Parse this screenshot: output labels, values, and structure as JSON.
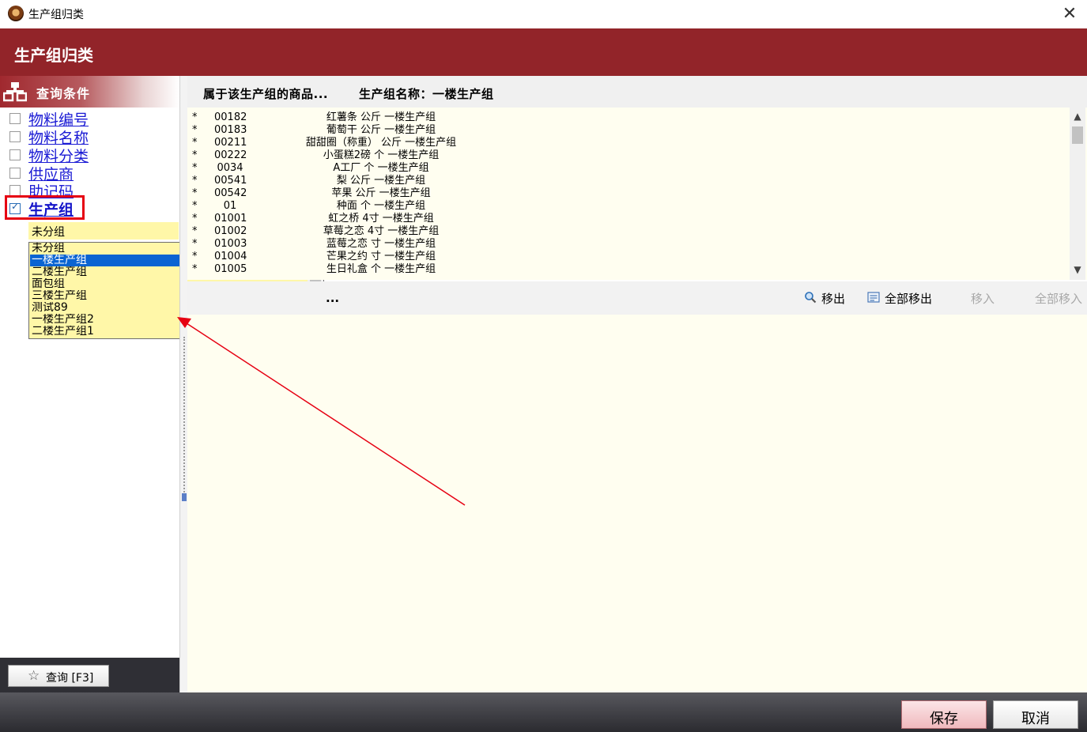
{
  "window": {
    "title": "生产组归类",
    "close_symbol": "✕"
  },
  "header": {
    "title": "生产组归类"
  },
  "left_panel": {
    "query_title": "查询条件",
    "filters": [
      {
        "label": "物料编号",
        "checked": false
      },
      {
        "label": "物料名称",
        "checked": false
      },
      {
        "label": "物料分类",
        "checked": false
      },
      {
        "label": "供应商",
        "checked": false
      },
      {
        "label": "助记码",
        "checked": false
      },
      {
        "label": "生产组",
        "checked": true
      }
    ],
    "group_select_value": "未分组",
    "dropdown_options": [
      {
        "label": "未分组",
        "selected": false
      },
      {
        "label": "一楼生产组",
        "selected": true
      },
      {
        "label": "二楼生产组",
        "selected": false
      },
      {
        "label": "面包组",
        "selected": false
      },
      {
        "label": "三楼生产组",
        "selected": false
      },
      {
        "label": "测试89",
        "selected": false
      },
      {
        "label": "一楼生产组2",
        "selected": false
      },
      {
        "label": "二楼生产组1",
        "selected": false
      }
    ],
    "query_button_label": "查询 [F3]"
  },
  "right_panel": {
    "belongs_label": "属于该生产组的商品...",
    "group_name_label": "生产组名称：一楼生产组",
    "rows": [
      {
        "star": "*",
        "code": "00182",
        "info": "红薯条  公斤  一楼生产组"
      },
      {
        "star": "*",
        "code": "00183",
        "info": "葡萄干  公斤  一楼生产组"
      },
      {
        "star": "*",
        "code": "00211",
        "info": "甜甜圈（称重） 公斤  一楼生产组"
      },
      {
        "star": "*",
        "code": "00222",
        "info": "小蛋糕2磅  个  一楼生产组"
      },
      {
        "star": "*",
        "code": "0034",
        "info": "A工厂  个  一楼生产组"
      },
      {
        "star": "*",
        "code": "00541",
        "info": "梨  公斤  一楼生产组"
      },
      {
        "star": "*",
        "code": "00542",
        "info": "苹果  公斤  一楼生产组"
      },
      {
        "star": "*",
        "code": "01",
        "info": "种面  个  一楼生产组"
      },
      {
        "star": "*",
        "code": "01001",
        "info": "虹之桥  4寸  一楼生产组"
      },
      {
        "star": "*",
        "code": "01002",
        "info": "草莓之恋  4寸  一楼生产组"
      },
      {
        "star": "*",
        "code": "01003",
        "info": "蓝莓之恋  寸  一楼生产组"
      },
      {
        "star": "*",
        "code": "01004",
        "info": "芒果之约  寸  一楼生产组"
      },
      {
        "star": "*",
        "code": "01005",
        "info": "生日礼盒  个  一楼生产组"
      }
    ],
    "other_label": "...",
    "toolbar": {
      "move_out": "移出",
      "move_out_all": "全部移出",
      "move_in": "移入",
      "move_in_all": "全部移入"
    }
  },
  "footer": {
    "save_label": "保存",
    "cancel_label": "取消"
  },
  "colors": {
    "header_red": "#922429",
    "highlight_red": "#e60012",
    "select_blue": "#0a64d2",
    "dropdown_yellow": "#fff7a8"
  }
}
